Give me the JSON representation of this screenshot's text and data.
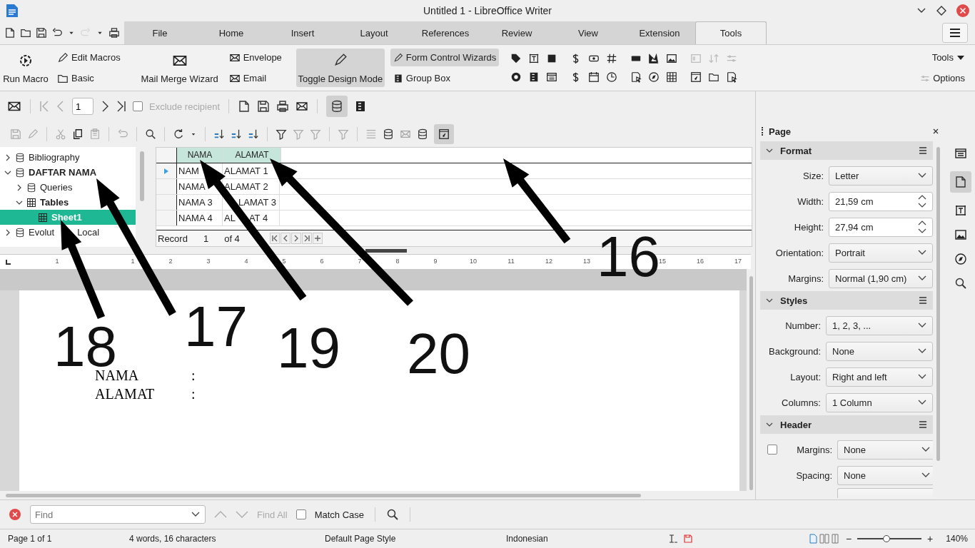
{
  "window": {
    "title": "Untitled 1 - LibreOffice Writer"
  },
  "tabs": [
    {
      "label": "File",
      "selected": false
    },
    {
      "label": "Home",
      "selected": false
    },
    {
      "label": "Insert",
      "selected": false
    },
    {
      "label": "Layout",
      "selected": false
    },
    {
      "label": "References",
      "selected": false
    },
    {
      "label": "Review",
      "selected": false
    },
    {
      "label": "View",
      "selected": false
    },
    {
      "label": "Extension",
      "selected": false
    },
    {
      "label": "Tools",
      "selected": true
    }
  ],
  "ribbon": {
    "run_macro": "Run Macro",
    "edit_macros": "Edit Macros",
    "basic": "Basic",
    "mail_merge_wizard": "Mail Merge Wizard",
    "envelope": "Envelope",
    "email": "Email",
    "toggle_design_mode": {
      "label": "Toggle Design Mode",
      "active": true
    },
    "form_control_wizards": {
      "label": "Form Control Wizards",
      "active": true
    },
    "group_box": "Group Box",
    "tools_menu": "Tools",
    "options": "Options"
  },
  "mail_merge_bar": {
    "record": "1",
    "exclude_recipient": {
      "label": "Exclude recipient",
      "checked": false,
      "disabled": true
    }
  },
  "data_sources": [
    {
      "label": "Bibliography",
      "expanded": false,
      "bold": false,
      "selected": false
    },
    {
      "label": "DAFTAR NAMA",
      "expanded": true,
      "bold": true,
      "selected": false,
      "children": [
        {
          "label": "Queries",
          "expanded": false,
          "bold": false,
          "selected": false
        },
        {
          "label": "Tables",
          "expanded": true,
          "bold": true,
          "selected": false,
          "children": [
            {
              "label": "Sheet1",
              "bold": true,
              "selected": true
            }
          ]
        }
      ]
    },
    {
      "parts": [
        "Evolut",
        "Local"
      ],
      "expanded": false,
      "bold": false,
      "selected": false
    }
  ],
  "grid": {
    "columns": [
      {
        "label": "NAMA",
        "selected": true
      },
      {
        "label": "ALAMAT",
        "selected": true
      }
    ],
    "rows": [
      {
        "cells": [
          {
            "parts": [
              "NAM"
            ],
            "covered_start": false
          },
          {
            "parts": [
              "ALAMAT 1"
            ],
            "covered_start": false
          }
        ],
        "current": true
      },
      {
        "cells": [
          {
            "parts": [
              "NAMA"
            ],
            "covered_start": false
          },
          {
            "parts": [
              "ALAMAT 2"
            ],
            "covered_start": false
          }
        ],
        "current": false
      },
      {
        "cells": [
          {
            "parts": [
              "NAMA 3"
            ],
            "covered_start": false
          },
          {
            "parts": [
              "LAMAT 3"
            ],
            "covered_start": true
          }
        ],
        "current": false
      },
      {
        "cells": [
          {
            "parts": [
              "NAMA 4"
            ],
            "covered_start": false
          },
          {
            "parts": [
              "AL",
              "AT 4"
            ],
            "covered_start": false
          }
        ],
        "current": false
      }
    ],
    "record_label": "Record",
    "record_number": "1",
    "record_total": "of 4"
  },
  "ruler": [
    "1",
    "1",
    "2",
    "3",
    "4",
    "5",
    "6",
    "7",
    "8",
    "9",
    "10",
    "11",
    "12",
    "13",
    "15",
    "16",
    "17"
  ],
  "document": {
    "lines": [
      {
        "label": "NAMA",
        "colon": ":"
      },
      {
        "label": "ALAMAT",
        "colon": ":"
      }
    ]
  },
  "sidebar": {
    "title": "Page",
    "sections": [
      {
        "title": "Format",
        "expanded": true,
        "rows": [
          {
            "kind": "dropdown",
            "label": "Size:",
            "value": "Letter"
          },
          {
            "kind": "spin",
            "label": "Width:",
            "value": "21,59 cm"
          },
          {
            "kind": "spin",
            "label": "Height:",
            "value": "27,94 cm"
          },
          {
            "kind": "dropdown",
            "label": "Orientation:",
            "value": "Portrait"
          },
          {
            "kind": "dropdown",
            "label": "Margins:",
            "value": "Normal (1,90 cm)"
          }
        ]
      },
      {
        "title": "Styles",
        "expanded": true,
        "rows": [
          {
            "kind": "dropdown",
            "label": "Number:",
            "value": "1, 2, 3, ..."
          },
          {
            "kind": "dropdown",
            "label": "Background:",
            "value": "None"
          },
          {
            "kind": "dropdown",
            "label": "Layout:",
            "value": "Right and left"
          },
          {
            "kind": "dropdown",
            "label": "Columns:",
            "value": "1 Column"
          }
        ]
      },
      {
        "title": "Header",
        "expanded": true,
        "rows": [
          {
            "kind": "check-dropdown",
            "checked": false,
            "label": "Margins:",
            "value": "None"
          },
          {
            "kind": "dropdown-indent",
            "label": "Spacing:",
            "value": "None"
          },
          {
            "kind": "dropdown-cut"
          }
        ]
      }
    ]
  },
  "find_bar": {
    "placeholder": "Find",
    "find_all": {
      "label": "Find All",
      "disabled": true
    },
    "match_case": {
      "label": "Match Case",
      "checked": false
    }
  },
  "status_bar": {
    "page": "Page 1 of 1",
    "words": "4 words, 16 characters",
    "page_style": "Default Page Style",
    "language": "Indonesian",
    "zoom": "140%",
    "zoom_out": "−",
    "zoom_in": "+",
    "zoom_level": {
      "level": 0.45
    }
  },
  "annotations": [
    {
      "label": "16"
    },
    {
      "label": "17"
    },
    {
      "label": "18"
    },
    {
      "label": "19"
    },
    {
      "label": "20"
    }
  ]
}
